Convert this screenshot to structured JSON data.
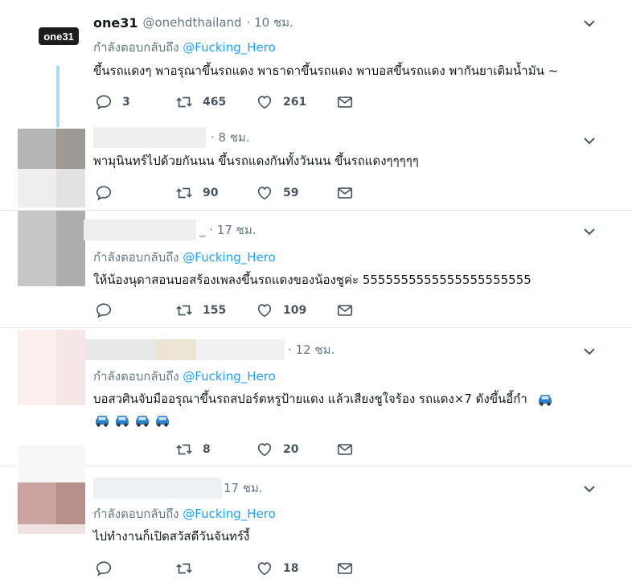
{
  "tweets": [
    {
      "name": "one31",
      "handle": "@onehdthailand",
      "time": "· 10 ชม.",
      "reply_prefix": "กำลังตอบกลับถึง",
      "reply_to": "@Fucking_Hero",
      "text": "ขึ้นรถแดงๆ พาอรุณาขึ้นรถแดง พาธาดาขึ้นรถแดง พาบอสขึ้นรถแดง พากันยาเติมน้ำมัน ~",
      "replies": "3",
      "retweets": "465",
      "likes": "261",
      "logo_text": "one31"
    },
    {
      "time": "· 8 ชม.",
      "text": "พามุนินทร์ไปด้วยกันนน ขึ้นรถแดงกันทั้งวันนน ขึ้นรถแดงๆๆๆๆๆ",
      "replies": "",
      "retweets": "90",
      "likes": "59"
    },
    {
      "time": "_ · 17 ชม.",
      "reply_prefix": "กำลังตอบกลับถึง",
      "reply_to": "@Fucking_Hero",
      "text": "ให้น้องนุดาสอนบอสร้องเพลงขึ้นรถแดงของน้องชูค่ะ 5555555555555555555555",
      "replies": "",
      "retweets": "155",
      "likes": "109"
    },
    {
      "time": "· 12 ชม.",
      "reply_prefix": "กำลังตอบกลับถึง",
      "reply_to": "@Fucking_Hero",
      "text": "บอสวศินจับมืออรุณาขึ้นรถสปอร์ตหรูป้ายแดง แล้วเสียงชูใจร้อง รถแดง×7 ดังขึ้นอี้กำ",
      "replies": "",
      "retweets": "8",
      "likes": "20"
    },
    {
      "time": "17 ชม.",
      "reply_prefix": "กำลังตอบกลับถึง",
      "reply_to": "@Fucking_Hero",
      "text": "ไปทำงานก็เปิดสวัสดีวันจันทร์งี้",
      "replies": "",
      "retweets": "",
      "likes": "18"
    }
  ],
  "icons": {
    "reply": "reply-icon",
    "retweet": "retweet-icon",
    "like": "heart-icon",
    "dm": "envelope-icon",
    "caret": "chevron-down-icon",
    "emoji": "car-emoji-icon"
  },
  "colors": {
    "link": "#1da1f2",
    "secondary": "#657786",
    "icon": "#4a5560",
    "divider": "#e6ecf0",
    "thread": "#a9dcf7",
    "car": "#2f80c7"
  }
}
